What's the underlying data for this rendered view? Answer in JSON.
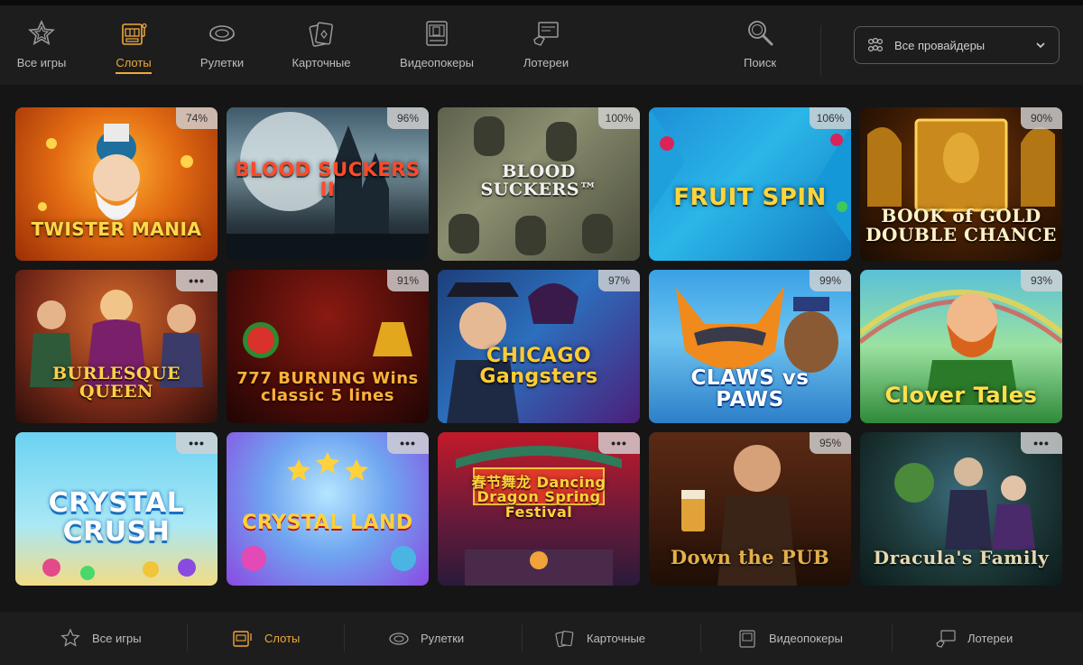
{
  "top_nav": {
    "items": [
      {
        "label": "Все игры",
        "icon": "star-icon"
      },
      {
        "label": "Слоты",
        "icon": "slot-machine-icon",
        "active": true
      },
      {
        "label": "Рулетки",
        "icon": "roulette-icon"
      },
      {
        "label": "Карточные",
        "icon": "cards-icon"
      },
      {
        "label": "Видеопокеры",
        "icon": "videopoker-icon"
      },
      {
        "label": "Лотереи",
        "icon": "lottery-icon"
      }
    ],
    "search_label": "Поиск",
    "provider_label": "Все провайдеры"
  },
  "games": [
    {
      "title": "TWISTER MANIA",
      "badge": "74%"
    },
    {
      "title": "BLOOD SUCKERS II",
      "badge": "96%"
    },
    {
      "title": "BLOOD SUCKERS™",
      "badge": "100%"
    },
    {
      "title": "FRUIT SPIN",
      "badge": "106%"
    },
    {
      "title": "BOOK of GOLD DOUBLE CHANCE",
      "badge": "90%"
    },
    {
      "title": "BURLESQUE QUEEN",
      "badge": "•••"
    },
    {
      "title": "777 BURNING Wins classic 5 lines",
      "badge": "91%"
    },
    {
      "title": "CHICAGO Gangsters",
      "badge": "97%"
    },
    {
      "title": "CLAWS vs PAWS",
      "badge": "99%"
    },
    {
      "title": "Clover Tales",
      "badge": "93%"
    },
    {
      "title": "CRYSTAL CRUSH",
      "badge": "•••"
    },
    {
      "title": "CRYSTAL LAND",
      "badge": "•••"
    },
    {
      "title": "春节舞龙 Dancing Dragon Spring Festival",
      "badge": "•••"
    },
    {
      "title": "Down the PUB",
      "badge": "95%"
    },
    {
      "title": "Dracula's Family",
      "badge": "•••"
    }
  ],
  "bottom_nav": {
    "items": [
      {
        "label": "Все игры",
        "icon": "star-icon"
      },
      {
        "label": "Слоты",
        "icon": "slot-machine-icon",
        "active": true
      },
      {
        "label": "Рулетки",
        "icon": "roulette-icon"
      },
      {
        "label": "Карточные",
        "icon": "cards-icon"
      },
      {
        "label": "Видеопокеры",
        "icon": "videopoker-icon"
      },
      {
        "label": "Лотереи",
        "icon": "lottery-icon"
      }
    ]
  },
  "colors": {
    "accent": "#f0a83a",
    "background": "#151515",
    "panel": "#1d1d1d"
  }
}
